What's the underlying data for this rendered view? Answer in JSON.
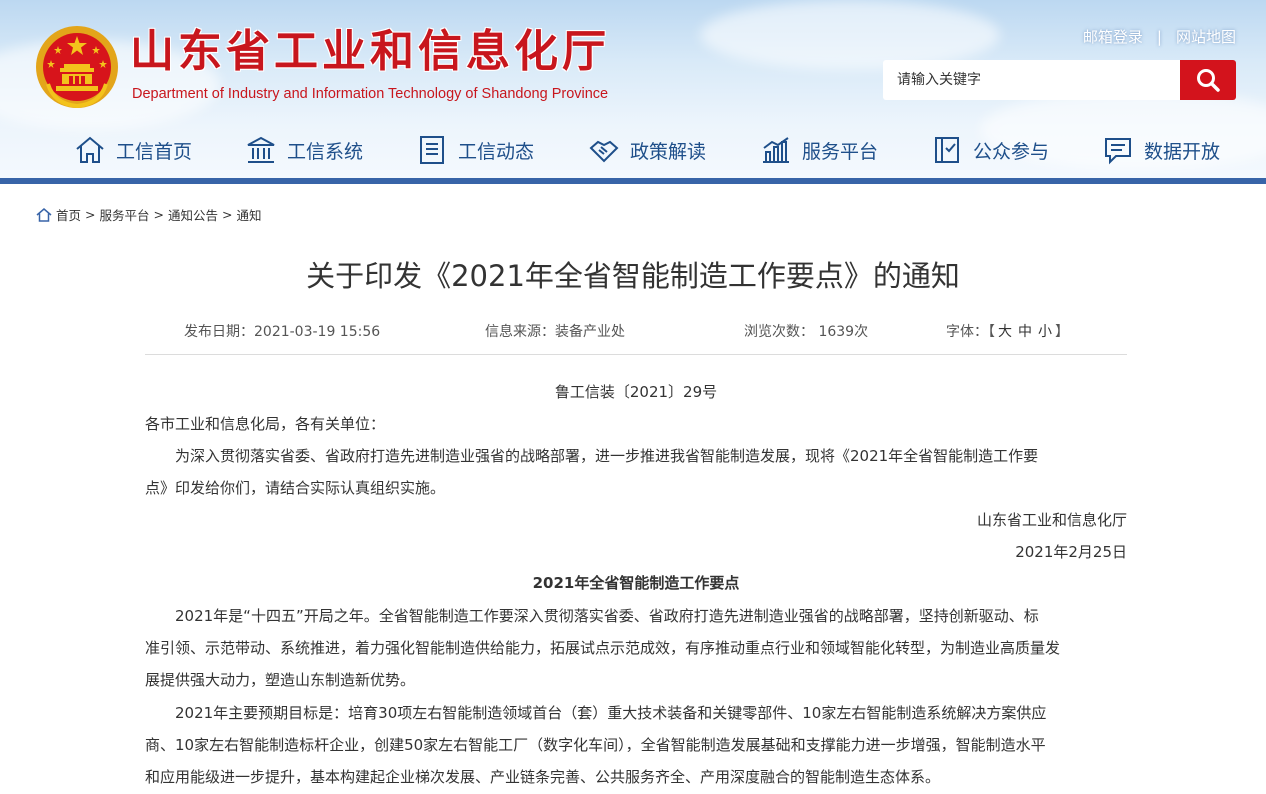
{
  "header": {
    "site_title": "山东省工业和信息化厅",
    "site_subtitle": "Department of Industry and Information Technology of Shandong Province",
    "links": [
      "邮箱登录",
      "网站地图"
    ],
    "search_placeholder": "请输入关键字",
    "brand_red": "#c8161d",
    "nav_blue": "#1e4f8a"
  },
  "nav": [
    {
      "label": "工信首页",
      "icon": "home-icon"
    },
    {
      "label": "工信系统",
      "icon": "building-icon"
    },
    {
      "label": "工信动态",
      "icon": "document-icon"
    },
    {
      "label": "政策解读",
      "icon": "handshake-icon"
    },
    {
      "label": "服务平台",
      "icon": "chart-icon"
    },
    {
      "label": "公众参与",
      "icon": "book-icon"
    },
    {
      "label": "数据开放",
      "icon": "chat-icon"
    }
  ],
  "breadcrumb": [
    "首页",
    "服务平台",
    "通知公告",
    "通知"
  ],
  "article": {
    "title": "关于印发《2021年全省智能制造工作要点》的通知",
    "publish_label": "发布日期：",
    "publish_date": "2021-03-19 15:56",
    "source_label": "信息来源：",
    "source": "装备产业处",
    "views_label": "浏览次数：",
    "views": "1639次",
    "font_label": "字体：",
    "font_options": [
      "大",
      "中",
      "小"
    ],
    "doc_number": "鲁工信装〔2021〕29号",
    "salutation": "各市工业和信息化局，各有关单位：",
    "para1_line1": "为深入贯彻落实省委、省政府打造先进制造业强省的战略部署，进一步推进我省智能制造发展，现将《2021年全省智能制造工作要",
    "para1_line2": "点》印发给你们，请结合实际认真组织实施。",
    "signature": "山东省工业和信息化厅",
    "sign_date": "2021年2月25日",
    "section_title": "2021年全省智能制造工作要点",
    "para2_line1": "2021年是“十四五”开局之年。全省智能制造工作要深入贯彻落实省委、省政府打造先进制造业强省的战略部署，坚持创新驱动、标",
    "para2_line2": "准引领、示范带动、系统推进，着力强化智能制造供给能力，拓展试点示范成效，有序推动重点行业和领域智能化转型，为制造业高质量发",
    "para2_line3": "展提供强大动力，塑造山东制造新优势。",
    "para3_line1": "2021年主要预期目标是：培育30项左右智能制造领域首台（套）重大技术装备和关键零部件、10家左右智能制造系统解决方案供应",
    "para3_line2": "商、10家左右智能制造标杆企业，创建50家左右智能工厂（数字化车间），全省智能制造发展基础和支撑能力进一步增强，智能制造水平",
    "para3_line3": "和应用能级进一步提升，基本构建起企业梯次发展、产业链条完善、公共服务齐全、产用深度融合的智能制造生态体系。"
  }
}
